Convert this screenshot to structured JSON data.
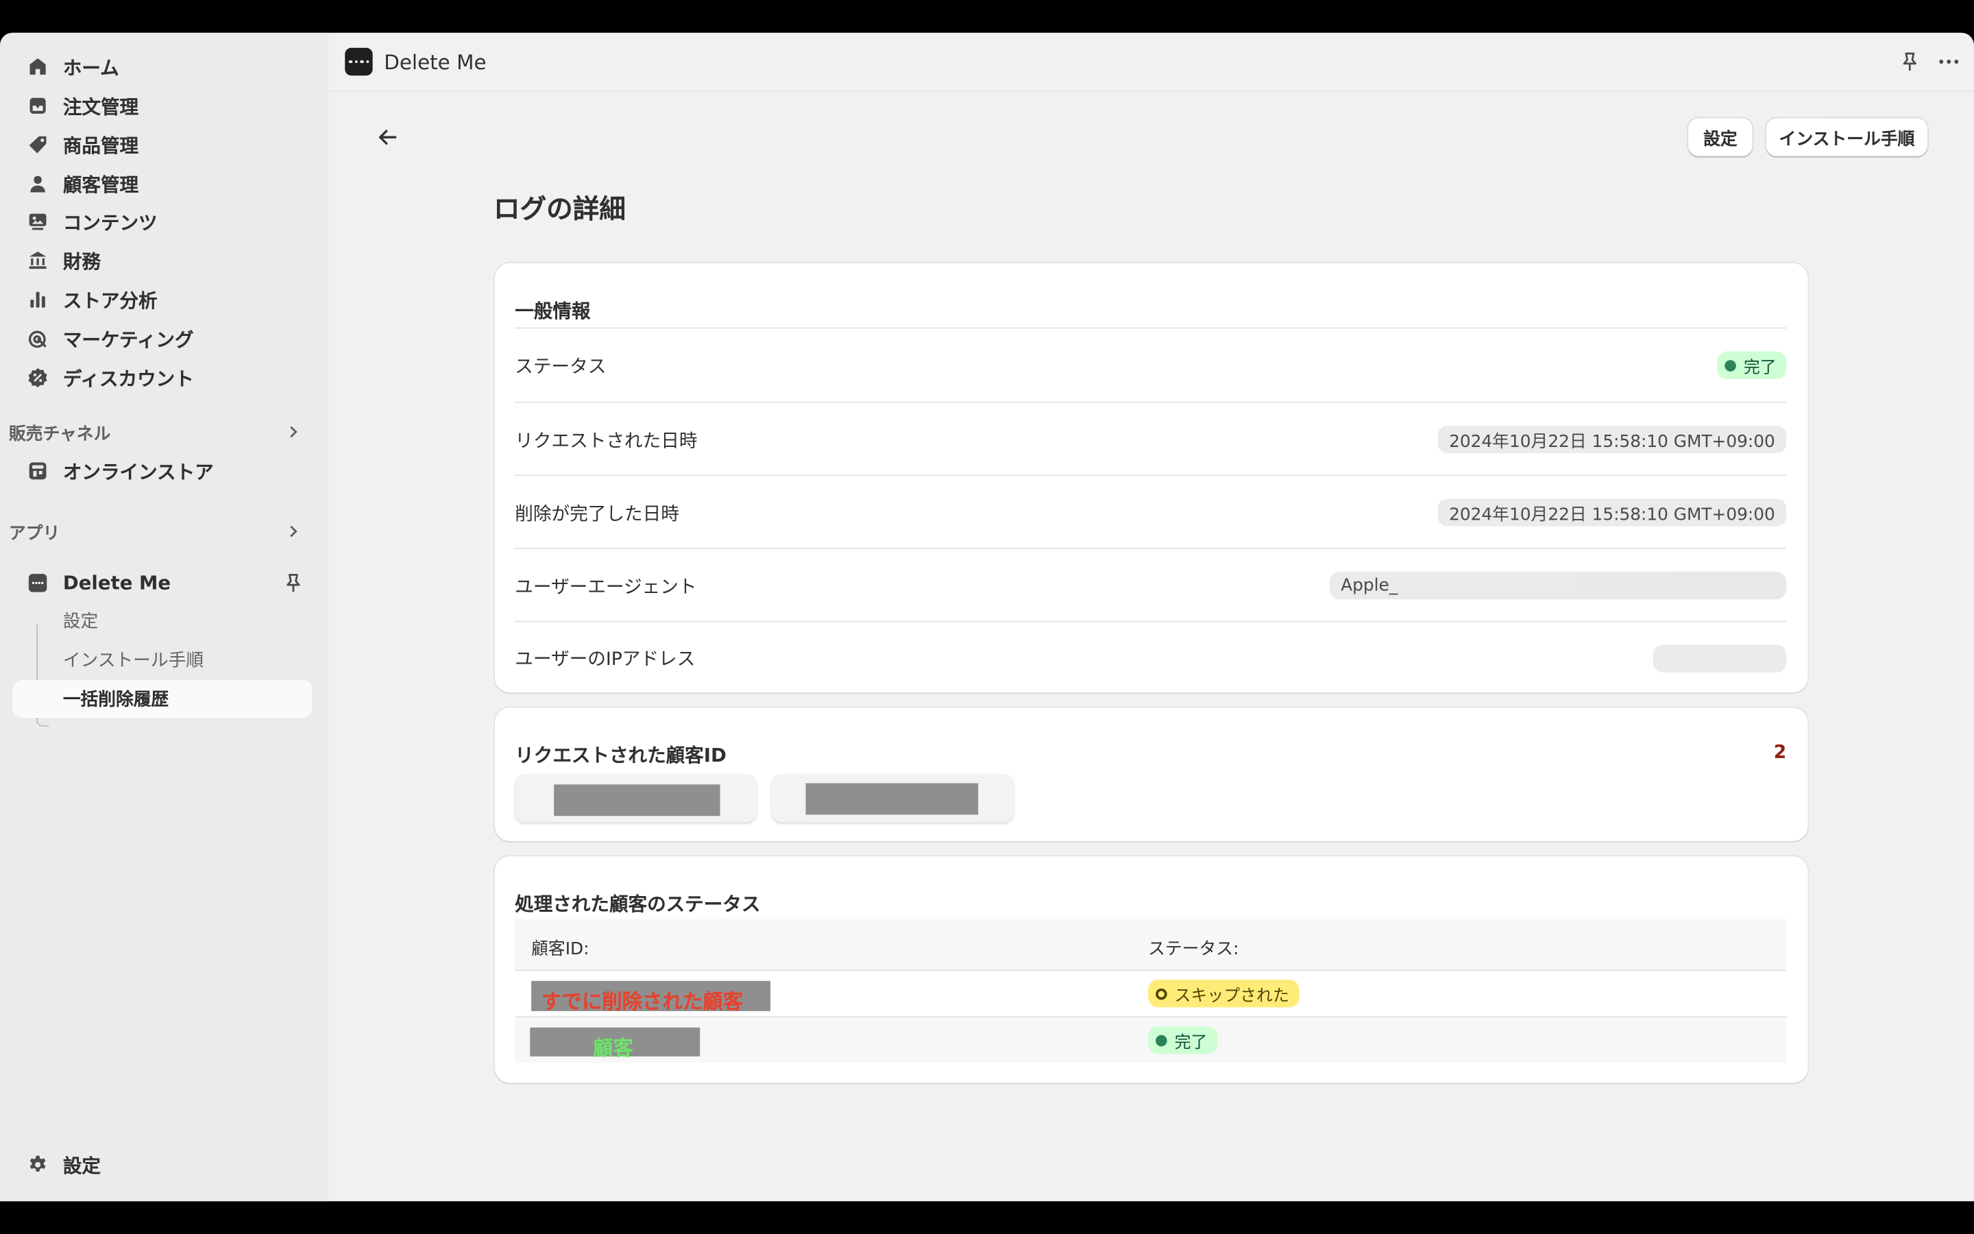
{
  "sidebar": {
    "nav": [
      {
        "label": "ホーム",
        "icon": "home-icon"
      },
      {
        "label": "注文管理",
        "icon": "inbox-icon"
      },
      {
        "label": "商品管理",
        "icon": "tag-icon"
      },
      {
        "label": "顧客管理",
        "icon": "person-icon"
      },
      {
        "label": "コンテンツ",
        "icon": "image-icon"
      },
      {
        "label": "財務",
        "icon": "bank-icon"
      },
      {
        "label": "ストア分析",
        "icon": "bar-chart-icon"
      },
      {
        "label": "マーケティング",
        "icon": "target-icon"
      },
      {
        "label": "ディスカウント",
        "icon": "discount-icon"
      }
    ],
    "sales_channels_label": "販売チャネル",
    "online_store": "オンラインストア",
    "apps_label": "アプリ",
    "app_name": "Delete Me",
    "app_sub": [
      "設定",
      "インストール手順",
      "一括削除履歴"
    ],
    "settings": "設定"
  },
  "topbar": {
    "title": "Delete Me"
  },
  "actions": {
    "settings": "設定",
    "install": "インストール手順"
  },
  "page": {
    "title": "ログの詳細"
  },
  "general": {
    "heading": "一般情報",
    "status_label": "ステータス",
    "status_value": "完了",
    "requested_label": "リクエストされた日時",
    "requested_value": "2024年10月22日 15:58:10 GMT+09:00",
    "completed_label": "削除が完了した日時",
    "completed_value": "2024年10月22日 15:58:10 GMT+09:00",
    "ua_label": "ユーザーエージェント",
    "ua_value": "Apple_",
    "ip_label": "ユーザーのIPアドレス"
  },
  "requested_ids": {
    "heading": "リクエストされた顧客ID",
    "count": "2"
  },
  "processed": {
    "heading": "処理された顧客のステータス",
    "col_id": "顧客ID:",
    "col_status": "ステータス:",
    "rows": [
      {
        "id_text": "すでに削除された顧客",
        "id_color": "#e8412c",
        "status": "スキップされた",
        "type": "warn"
      },
      {
        "id_text": "顧客",
        "id_color": "#6ee16a",
        "status": "完了",
        "type": "ok"
      }
    ]
  }
}
